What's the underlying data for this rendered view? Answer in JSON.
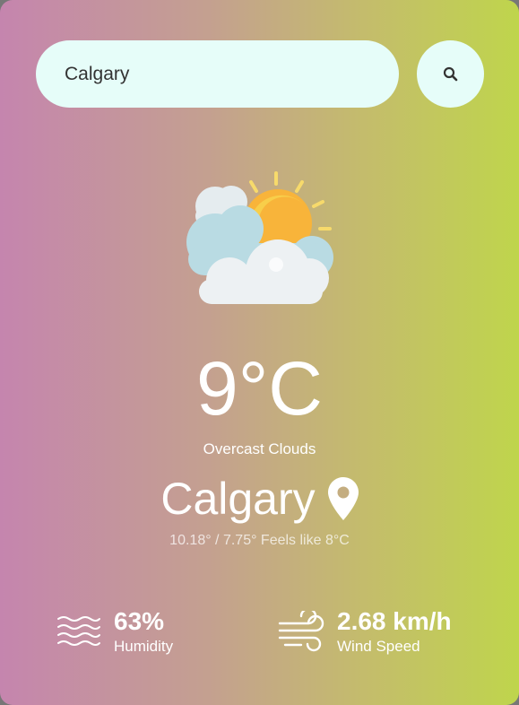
{
  "search": {
    "value": "Calgary",
    "button_icon": "search-icon"
  },
  "weather": {
    "icon": "partly-cloudy-sun-icon",
    "temperature": "9°C",
    "description": "Overcast Clouds",
    "city": "Calgary",
    "location_icon": "location-pin-icon",
    "range": "10.18° / 7.75° Feels like 8°C"
  },
  "stats": {
    "humidity": {
      "value": "63%",
      "label": "Humidity",
      "icon": "humidity-waves-icon"
    },
    "wind": {
      "value": "2.68 km/h",
      "label": "Wind Speed",
      "icon": "wind-icon"
    }
  },
  "colors": {
    "gradient_left": "#c585ae",
    "gradient_right": "#bfd54c",
    "input_bg": "#e6fdf9"
  }
}
